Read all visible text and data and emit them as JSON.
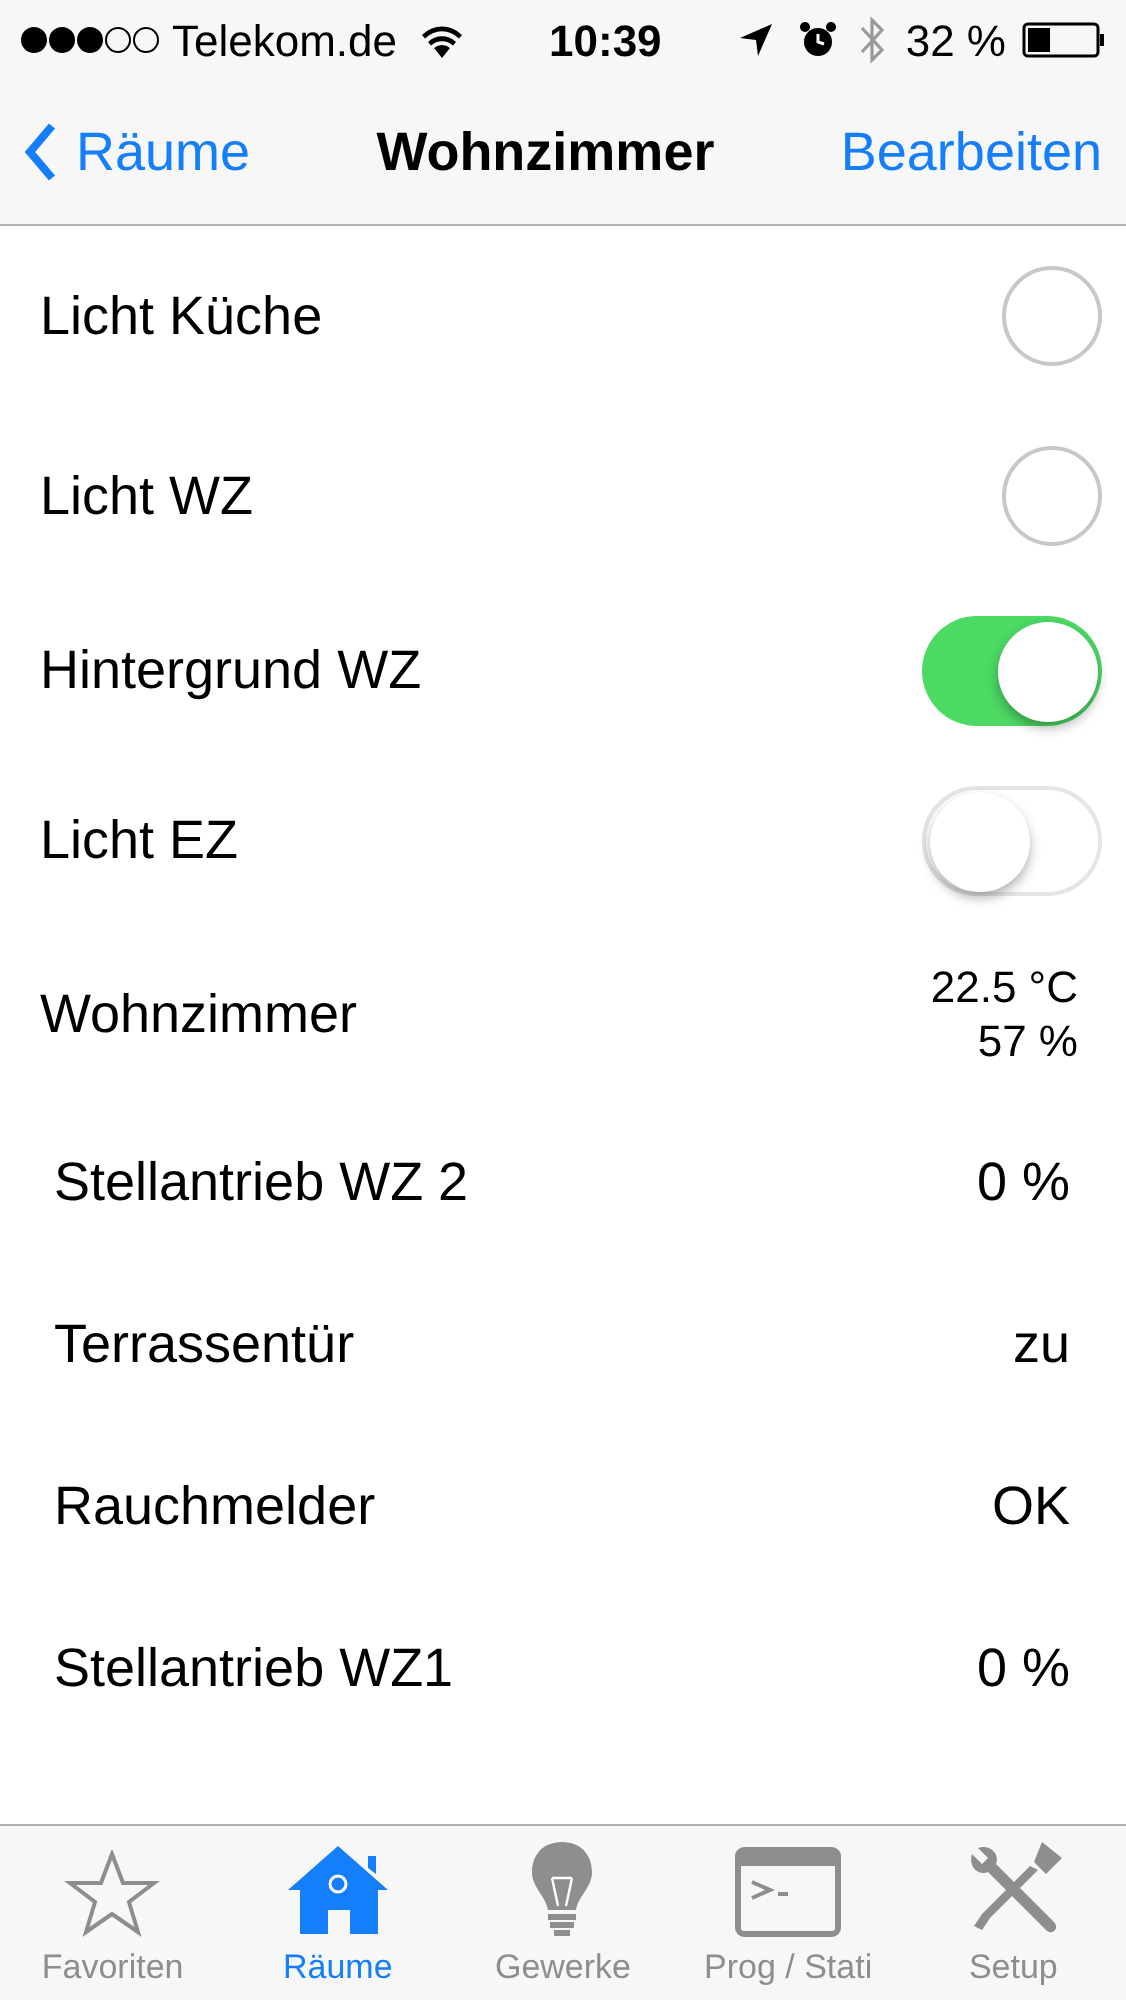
{
  "status_bar": {
    "carrier": "Telekom.de",
    "time": "10:39",
    "battery": "32 %"
  },
  "nav_bar": {
    "back": "Räume",
    "title": "Wohnzimmer",
    "action": "Bearbeiten"
  },
  "rows": [
    {
      "kind": "button",
      "label": "Licht Küche",
      "on": false
    },
    {
      "kind": "button",
      "label": "Licht WZ",
      "on": false
    },
    {
      "kind": "switch",
      "label": "Hintergrund WZ",
      "on": true
    },
    {
      "kind": "switch",
      "label": "Licht EZ",
      "on": false
    },
    {
      "kind": "climate",
      "label": "Wohnzimmer",
      "values": [
        "22.5 °C",
        "57 %"
      ]
    },
    {
      "kind": "value",
      "label": "Stellantrieb WZ 2",
      "value": "0 %"
    },
    {
      "kind": "value",
      "label": "Terrassentür",
      "value": "zu"
    },
    {
      "kind": "value",
      "label": "Rauchmelder",
      "value": "OK"
    },
    {
      "kind": "value",
      "label": "Stellantrieb WZ1",
      "value": "0 %"
    }
  ],
  "tab_bar": [
    {
      "kind": "star",
      "label": "Favoriten",
      "selected": false
    },
    {
      "kind": "house",
      "label": "Räume",
      "selected": true
    },
    {
      "kind": "bulb",
      "label": "Gewerke",
      "selected": false
    },
    {
      "kind": "terminal",
      "label": "Prog / Stati",
      "selected": false
    },
    {
      "kind": "tools",
      "label": "Setup",
      "selected": false
    }
  ]
}
